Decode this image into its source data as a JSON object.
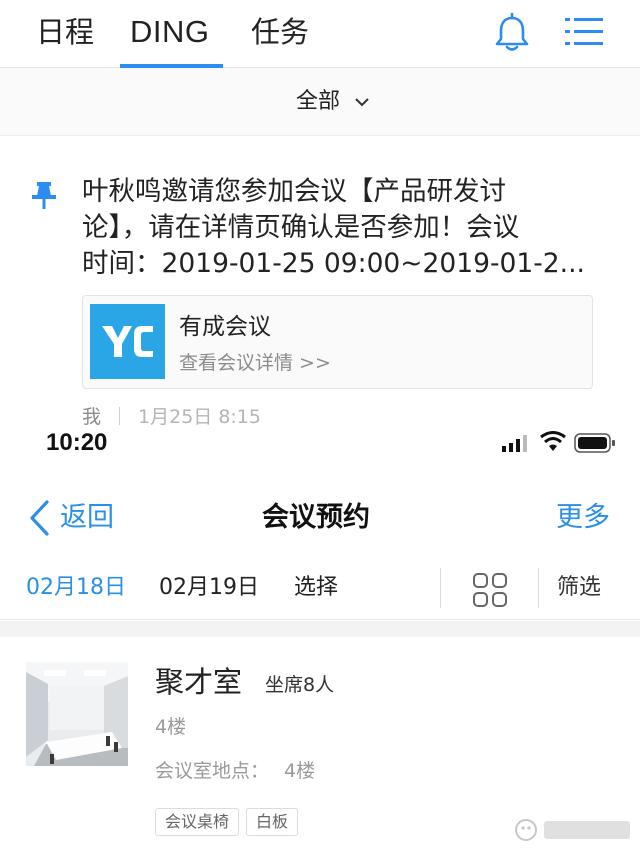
{
  "topnav": {
    "tabs": [
      {
        "label": "日程"
      },
      {
        "label": "DING"
      },
      {
        "label": "任务"
      }
    ],
    "active_tab": "DING"
  },
  "filter": {
    "label": "全部"
  },
  "message": {
    "line1": "叶秋鸣邀请您参加会议【产品研发讨",
    "line2": "论】，请在详情页确认是否参加！会议",
    "line3": "时间：2019-01-25 09:00~2019-01-2..."
  },
  "card": {
    "logo_text": "YC",
    "title": "有成会议",
    "subtitle": "查看会议详情 >>"
  },
  "meta": {
    "sender": "我",
    "time": "1月25日 8:15"
  },
  "statusbar": {
    "time": "10:20"
  },
  "navbar": {
    "back": "返回",
    "title": "会议预约",
    "more": "更多"
  },
  "datebar": {
    "dates": [
      "02月18日",
      "02月19日"
    ],
    "choose": "选择",
    "filter": "筛选"
  },
  "room": {
    "name": "聚才室",
    "seats": "坐席8人",
    "floor": "4楼",
    "location_label": "会议室地点：",
    "location_value": "4楼",
    "tags": [
      "会议桌椅",
      "白板"
    ]
  },
  "colors": {
    "accent": "#2a8fe8",
    "ding_underline": "#2d8cf0",
    "logo_bg": "#2aa6e6"
  }
}
